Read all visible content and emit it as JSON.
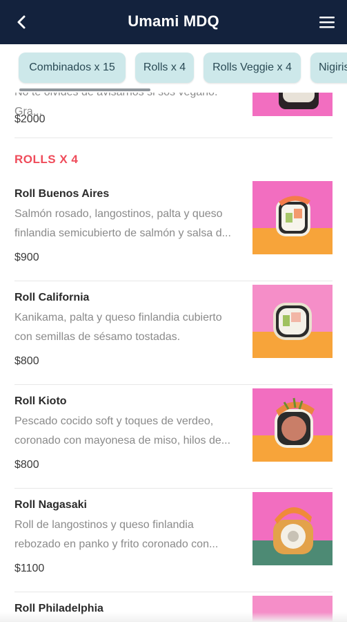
{
  "header": {
    "title": "Umami MDQ",
    "back_icon": "chevron-left-icon",
    "menu_icon": "hamburger-menu-icon"
  },
  "categories": [
    "Combinados x 15",
    "Rolls x 4",
    "Rolls Veggie x 4",
    "Nigiris"
  ],
  "previous_item": {
    "desc_fragment": "No te olvides de avisarnos si sos vegano. Gra...",
    "price": "$2000"
  },
  "section": {
    "title": "ROLLS X 4",
    "items": [
      {
        "name": "Roll Buenos Aires",
        "desc1": "Salmón rosado, langostinos, palta y queso",
        "desc2": "finlandia semicubierto de salmón y salsa d...",
        "price": "$900"
      },
      {
        "name": "Roll California",
        "desc1": "Kanikama, palta y queso finlandia cubierto",
        "desc2": "con semillas de sésamo tostadas.",
        "price": "$800"
      },
      {
        "name": "Roll Kioto",
        "desc1": "Pescado cocido soft y toques de verdeo,",
        "desc2": "coronado con mayonesa de miso, hilos de...",
        "price": "$800"
      },
      {
        "name": "Roll Nagasaki",
        "desc1": "Roll de langostinos y queso finlandia",
        "desc2": "rebozado en panko y frito coronado con...",
        "price": "$1100"
      },
      {
        "name": "Roll Philadelphia"
      }
    ]
  },
  "colors": {
    "header_bg": "#13223d",
    "chip_bg": "#cde8ea",
    "section_accent": "#ef4b5a",
    "photo_pink": "#f26ec0",
    "photo_orange": "#f7a43a"
  }
}
